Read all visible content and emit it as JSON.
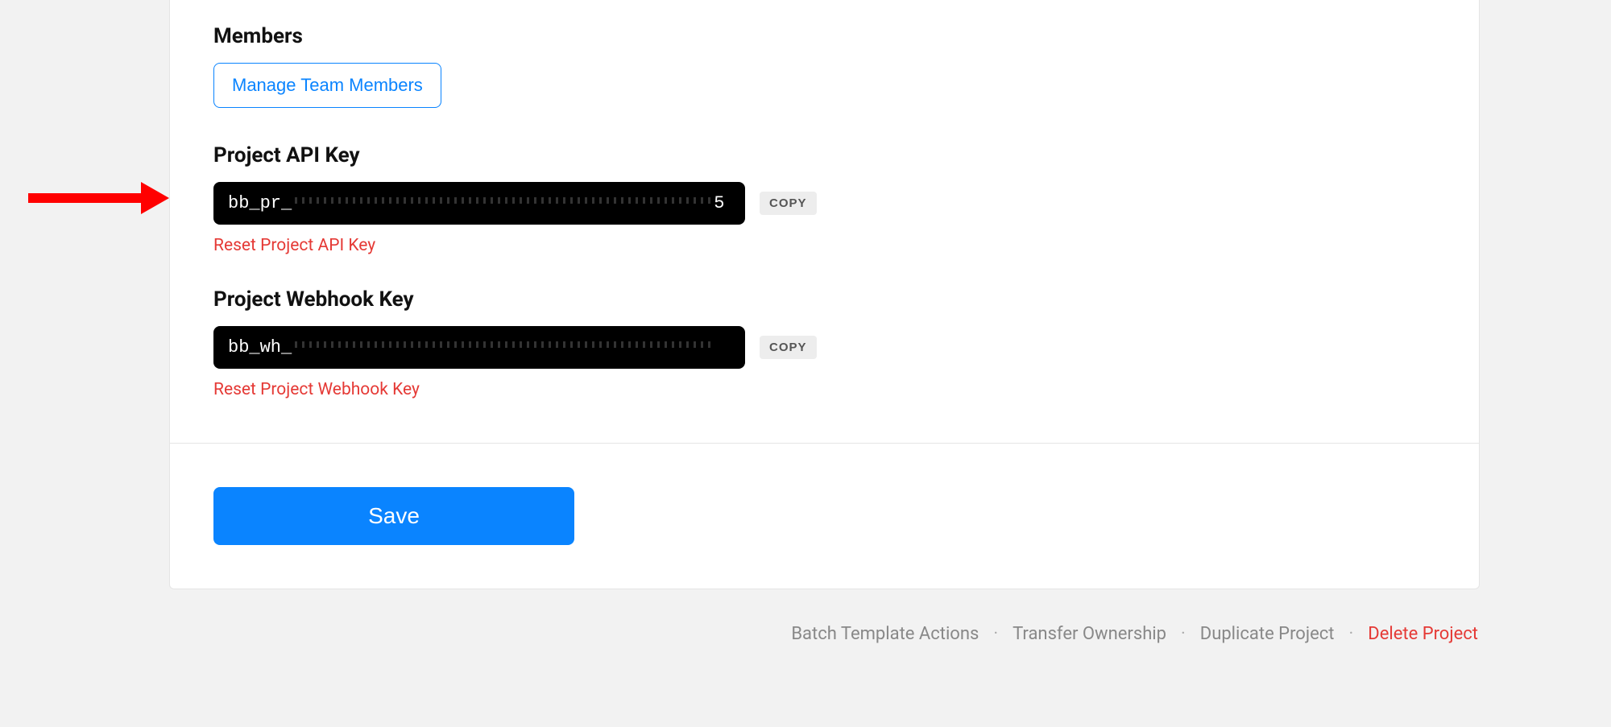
{
  "sections": {
    "members": {
      "heading": "Members",
      "manage_button": "Manage Team Members"
    },
    "api_key": {
      "heading": "Project API Key",
      "key_prefix": "bb_pr_",
      "key_suffix": "5",
      "copy_label": "COPY",
      "reset_label": "Reset Project API Key"
    },
    "webhook_key": {
      "heading": "Project Webhook Key",
      "key_prefix": "bb_wh_",
      "key_suffix": "",
      "copy_label": "COPY",
      "reset_label": "Reset Project Webhook Key"
    }
  },
  "actions": {
    "save": "Save"
  },
  "footer": {
    "batch_template": "Batch Template Actions",
    "transfer": "Transfer Ownership",
    "duplicate": "Duplicate Project",
    "delete": "Delete Project",
    "separator": "·"
  }
}
